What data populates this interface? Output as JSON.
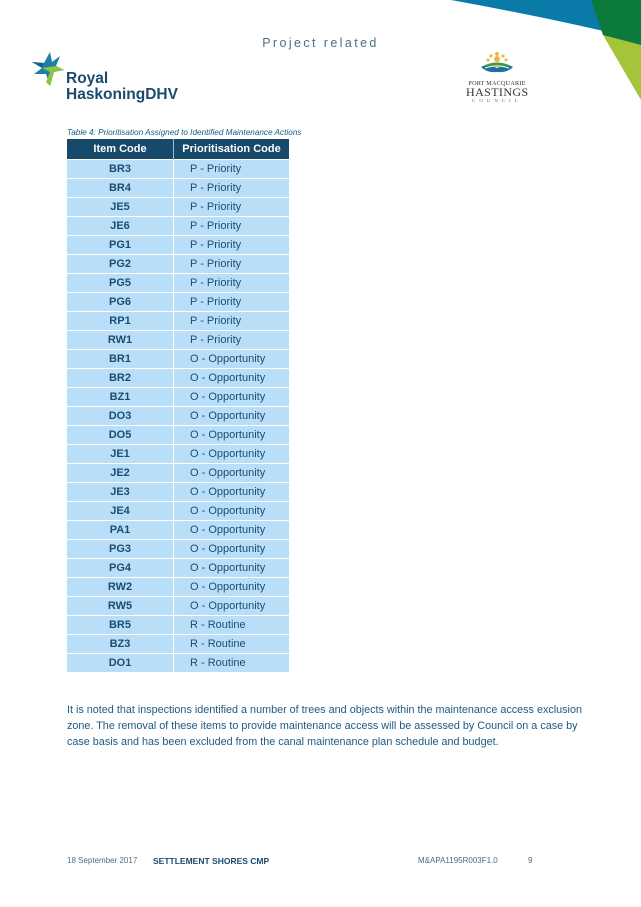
{
  "header": {
    "label": "Project related",
    "left_logo": {
      "icon": "royal-haskoningdhv-star-icon",
      "line1": "Royal",
      "line2": "HaskoningDHV"
    },
    "right_logo": {
      "icon": "port-macquarie-sun-hills-icon",
      "line1": "PORT MACQUARIE",
      "line2": "HASTINGS",
      "line3": "COUNCIL"
    },
    "corner_colors": {
      "blue": "#0a7aa8",
      "green": "#0b7a3c",
      "lime": "#a4c43a"
    }
  },
  "table": {
    "caption": "Table 4:  Prioritisation Assigned to Identified Maintenance Actions",
    "columns": [
      "Item Code",
      "Prioritisation Code"
    ],
    "rows": [
      [
        "BR3",
        "P - Priority"
      ],
      [
        "BR4",
        "P - Priority"
      ],
      [
        "JE5",
        "P - Priority"
      ],
      [
        "JE6",
        "P - Priority"
      ],
      [
        "PG1",
        "P - Priority"
      ],
      [
        "PG2",
        "P - Priority"
      ],
      [
        "PG5",
        "P - Priority"
      ],
      [
        "PG6",
        "P - Priority"
      ],
      [
        "RP1",
        "P - Priority"
      ],
      [
        "RW1",
        "P - Priority"
      ],
      [
        "BR1",
        "O - Opportunity"
      ],
      [
        "BR2",
        "O - Opportunity"
      ],
      [
        "BZ1",
        "O - Opportunity"
      ],
      [
        "DO3",
        "O - Opportunity"
      ],
      [
        "DO5",
        "O - Opportunity"
      ],
      [
        "JE1",
        "O - Opportunity"
      ],
      [
        "JE2",
        "O - Opportunity"
      ],
      [
        "JE3",
        "O - Opportunity"
      ],
      [
        "JE4",
        "O - Opportunity"
      ],
      [
        "PA1",
        "O - Opportunity"
      ],
      [
        "PG3",
        "O - Opportunity"
      ],
      [
        "PG4",
        "O - Opportunity"
      ],
      [
        "RW2",
        "O - Opportunity"
      ],
      [
        "RW5",
        "O - Opportunity"
      ],
      [
        "BR5",
        "R - Routine"
      ],
      [
        "BZ3",
        "R - Routine"
      ],
      [
        "DO1",
        "R - Routine"
      ]
    ],
    "header_color": "#17496b",
    "row_color": "#b9dff8"
  },
  "body": {
    "paragraph": "It is noted that inspections identified a number of trees and objects within the maintenance access exclusion zone.  The removal of these items to provide maintenance access will be assessed by Council on a case by case basis and has been excluded from the canal maintenance plan schedule and budget."
  },
  "footer": {
    "date": "18 September 2017",
    "title": "SETTLEMENT SHORES CMP",
    "reference": "M&APA1195R003F1.0",
    "page": "9"
  }
}
